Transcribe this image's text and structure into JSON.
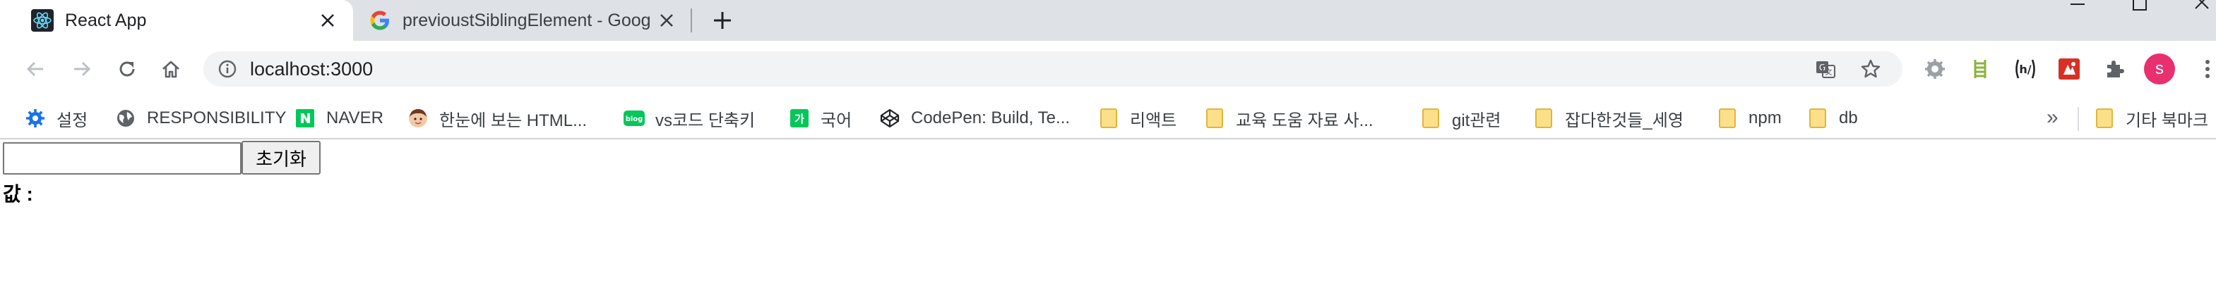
{
  "tabs": [
    {
      "title": "React App",
      "active": true,
      "favicon": "react-icon"
    },
    {
      "title": "previoustSiblingElement - Goog",
      "active": false,
      "favicon": "google-icon"
    }
  ],
  "address_bar": {
    "url": "localhost:3000",
    "security_icon": "info-icon"
  },
  "toolbar_icons": [
    "back-icon",
    "forward-icon",
    "reload-icon",
    "home-icon",
    "translate-icon",
    "bookmark-star-icon",
    "extension-gear-icon",
    "extension-ladder-icon",
    "extension-hj-icon",
    "extension-red-icon",
    "extensions-puzzle-icon"
  ],
  "profile": {
    "initial": "s",
    "color": "#e8306f"
  },
  "bookmarks": [
    {
      "label": "설정",
      "icon": "gear-icon"
    },
    {
      "label": "RESPONSIBILITY",
      "icon": "globe-icon"
    },
    {
      "label": "NAVER",
      "icon": "naver-icon"
    },
    {
      "label": "한눈에 보는 HTML...",
      "icon": "avatar-icon"
    },
    {
      "label": "vs코드 단축키",
      "icon": "blog-icon"
    },
    {
      "label": "국어",
      "icon": "ga-icon"
    },
    {
      "label": "CodePen: Build, Te...",
      "icon": "codepen-icon"
    },
    {
      "label": "리액트",
      "icon": "folder-icon"
    },
    {
      "label": "교육 도움 자료 사...",
      "icon": "folder-icon"
    },
    {
      "label": "git관련",
      "icon": "folder-icon"
    },
    {
      "label": "잡다한것들_세영",
      "icon": "folder-icon"
    },
    {
      "label": "npm",
      "icon": "folder-icon"
    },
    {
      "label": "db",
      "icon": "folder-icon"
    },
    {
      "label": "기타 북마크",
      "icon": "folder-icon"
    }
  ],
  "bookmarks_overflow": "»",
  "page": {
    "input_value": "",
    "reset_button": "초기화",
    "value_label": "값 :"
  }
}
